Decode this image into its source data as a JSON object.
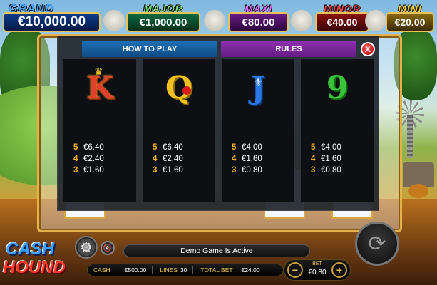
{
  "jackpots": {
    "grand": {
      "title": "GRAND",
      "value": "€10,000.00"
    },
    "major": {
      "title": "MAJOR",
      "value": "€1,000.00"
    },
    "maxi": {
      "title": "MAXI",
      "value": "€80.00"
    },
    "minor": {
      "title": "MINOR",
      "value": "€40.00"
    },
    "mini": {
      "title": "MINI",
      "value": "€20.00"
    }
  },
  "rules_panel": {
    "tabs": [
      {
        "label": "HOW TO PLAY",
        "active": false
      },
      {
        "label": "RULES",
        "active": true
      }
    ],
    "close_label": "X",
    "paytable": [
      {
        "symbol": "K",
        "icon": "king-card-icon",
        "pays": [
          {
            "count": "5",
            "value": "€6.40"
          },
          {
            "count": "4",
            "value": "€2.40"
          },
          {
            "count": "3",
            "value": "€1.60"
          }
        ]
      },
      {
        "symbol": "Q",
        "icon": "queen-card-icon",
        "pays": [
          {
            "count": "5",
            "value": "€6.40"
          },
          {
            "count": "4",
            "value": "€2.40"
          },
          {
            "count": "3",
            "value": "€1.60"
          }
        ]
      },
      {
        "symbol": "J",
        "icon": "jack-card-icon",
        "pays": [
          {
            "count": "5",
            "value": "€4.00"
          },
          {
            "count": "4",
            "value": "€1.60"
          },
          {
            "count": "3",
            "value": "€0.80"
          }
        ]
      },
      {
        "symbol": "9",
        "icon": "nine-card-icon",
        "pays": [
          {
            "count": "5",
            "value": "€4.00"
          },
          {
            "count": "4",
            "value": "€1.60"
          },
          {
            "count": "3",
            "value": "€0.80"
          }
        ]
      }
    ]
  },
  "logo": {
    "line1": "CASH",
    "line2": "HOUND"
  },
  "controls": {
    "demo_message": "Demo Game Is Active",
    "cash_label": "CASH",
    "cash_value": "€500.00",
    "lines_label": "LINES",
    "lines_value": "30",
    "total_bet_label": "TOTAL BET",
    "total_bet_value": "€24.00",
    "bet_label": "BET",
    "bet_value": "€0.80",
    "bet_minus": "−",
    "bet_plus": "+"
  },
  "colors": {
    "tab_howto": "#1d6fb5",
    "tab_rules": "#8e2fb0",
    "pay_count": "#f5b21e",
    "grand": "#4aa6ff",
    "major": "#7ee07a",
    "maxi": "#e06bff",
    "minor": "#ff4a4a",
    "mini": "#ffcc33"
  }
}
